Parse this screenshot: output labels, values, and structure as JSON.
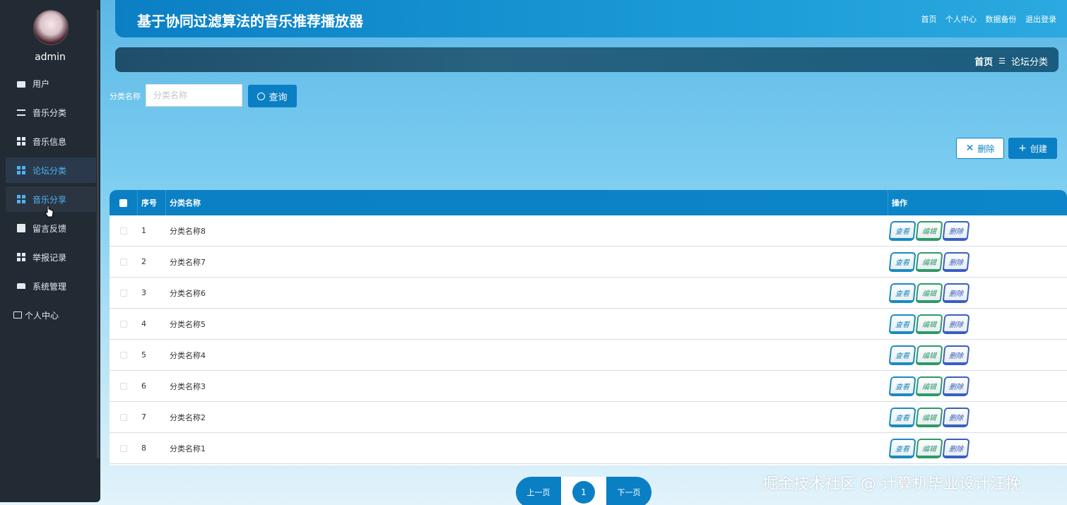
{
  "sidebar": {
    "username": "admin",
    "items": [
      {
        "label": "用户",
        "icon": "briefcase-icon"
      },
      {
        "label": "音乐分类",
        "icon": "sliders-icon"
      },
      {
        "label": "音乐信息",
        "icon": "grid-icon"
      },
      {
        "label": "论坛分类",
        "icon": "grid-icon",
        "active": true
      },
      {
        "label": "音乐分享",
        "icon": "grid-icon",
        "hover": true
      },
      {
        "label": "留言反馈",
        "icon": "clipboard-icon"
      },
      {
        "label": "举报记录",
        "icon": "grid-icon"
      },
      {
        "label": "系统管理",
        "icon": "pin-icon"
      },
      {
        "label": "个人中心",
        "icon": "card-icon"
      }
    ]
  },
  "header": {
    "title": "基于协同过滤算法的音乐推荐播放器",
    "links": [
      "首页",
      "个人中心",
      "数据备份",
      "退出登录"
    ]
  },
  "breadcrumb": {
    "home": "首页",
    "separator": "☰",
    "current": "论坛分类"
  },
  "search": {
    "label": "分类名称",
    "placeholder": "分类名称",
    "value": "",
    "button": "查询"
  },
  "actions": {
    "delete": "删除",
    "create": "创建"
  },
  "table": {
    "headers": {
      "index": "序号",
      "name": "分类名称",
      "ops": "操作"
    },
    "op_labels": {
      "view": "查看",
      "edit": "编辑",
      "delete": "删除"
    },
    "rows": [
      {
        "index": "1",
        "name": "分类名称8"
      },
      {
        "index": "2",
        "name": "分类名称7"
      },
      {
        "index": "3",
        "name": "分类名称6"
      },
      {
        "index": "4",
        "name": "分类名称5"
      },
      {
        "index": "5",
        "name": "分类名称4"
      },
      {
        "index": "6",
        "name": "分类名称3"
      },
      {
        "index": "7",
        "name": "分类名称2"
      },
      {
        "index": "8",
        "name": "分类名称1"
      }
    ]
  },
  "pagination": {
    "prev": "上一页",
    "current": "1",
    "next": "下一页"
  },
  "watermark": "掘金技术社区 @ 计算机毕业设计汪挽",
  "colors": {
    "primary": "#0b7fc4",
    "sidebar_bg": "#222a33",
    "active_text": "#4fb2f0"
  }
}
